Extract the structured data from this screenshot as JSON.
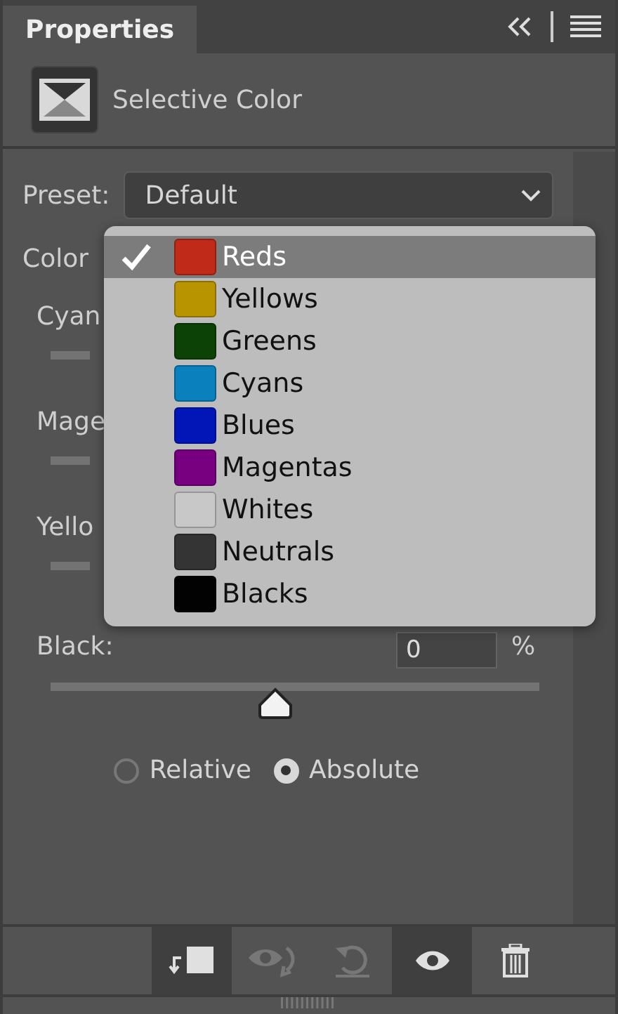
{
  "panel": {
    "tab": {
      "label": "Properties",
      "selected": true
    },
    "header_buttons": [
      {
        "kind": "collapse"
      },
      {
        "kind": "menu"
      }
    ]
  },
  "adjustment": {
    "title": "Selective Color"
  },
  "preset": {
    "label": "Preset:",
    "value": "Default"
  },
  "colors_label": "Color",
  "sliders": [
    {
      "label": "Cyan"
    },
    {
      "label": "Mage"
    },
    {
      "label": "Yello"
    }
  ],
  "black": {
    "label": "Black:",
    "value": "0",
    "unit": "%",
    "level": 0.46
  },
  "mode": [
    {
      "label": "Relative",
      "selected": false
    },
    {
      "label": "Absolute",
      "selected": true
    }
  ],
  "menu": [
    {
      "label": "Reds",
      "color": "#c02a18",
      "selected": true
    },
    {
      "label": "Yellows",
      "color": "#b89500",
      "selected": false
    },
    {
      "label": "Greens",
      "color": "#0c4206",
      "selected": false
    },
    {
      "label": "Cyans",
      "color": "#0a80bd",
      "selected": false
    },
    {
      "label": "Blues",
      "color": "#0216b8",
      "selected": false
    },
    {
      "label": "Magentas",
      "color": "#780080",
      "selected": false
    },
    {
      "label": "Whites",
      "color": "#c8c8c8",
      "selected": false
    },
    {
      "label": "Neutrals",
      "color": "#343434",
      "selected": false
    },
    {
      "label": "Blacks",
      "color": "#020202",
      "selected": false
    }
  ],
  "footer": [
    {
      "kind": "clip",
      "pressed": true,
      "disabled": false
    },
    {
      "kind": "view-previous",
      "pressed": false,
      "disabled": true
    },
    {
      "kind": "reset",
      "pressed": false,
      "disabled": true
    },
    {
      "kind": "visibility",
      "pressed": true,
      "disabled": false
    },
    {
      "kind": "delete",
      "pressed": false,
      "disabled": false
    }
  ]
}
